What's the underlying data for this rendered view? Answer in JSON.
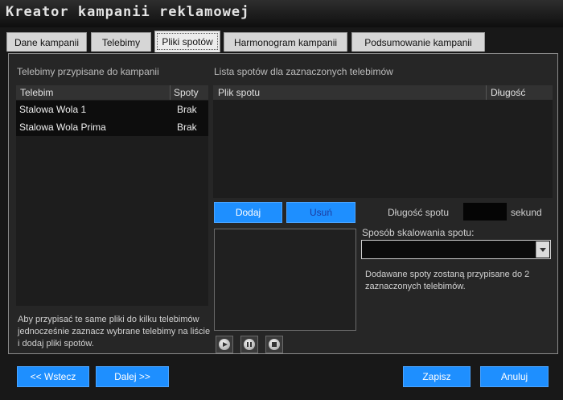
{
  "window": {
    "title": "Kreator kampanii reklamowej"
  },
  "tabs": [
    {
      "label": "Dane kampanii"
    },
    {
      "label": "Telebimy"
    },
    {
      "label": "Pliki spotów",
      "active": true
    },
    {
      "label": "Harmonogram kampanii"
    },
    {
      "label": "Podsumowanie kampanii"
    }
  ],
  "left": {
    "section_label": "Telebimy przypisane do kampanii",
    "columns": [
      "Telebim",
      "Spoty"
    ],
    "rows": [
      {
        "name": "Stalowa Wola 1",
        "spots": "Brak"
      },
      {
        "name": "Stalowa Wola Prima",
        "spots": "Brak"
      }
    ],
    "hint": "Aby przypisać te same pliki do kilku telebimów jednocześnie zaznacz wybrane telebimy na liście i dodaj pliki spotów."
  },
  "right": {
    "section_label": "Lista spotów dla zaznaczonych telebimów",
    "columns": [
      "Plik spotu",
      "Długość"
    ],
    "add_label": "Dodaj",
    "remove_label": "Usuń",
    "duration_label": "Długość spotu",
    "duration_value": "",
    "duration_unit": "sekund",
    "scaling_label": "Sposób skalowania spotu:",
    "scaling_value": "",
    "info": "Dodawane spoty zostaną przypisane do 2 zaznaczonych telebimów."
  },
  "player": {
    "icons": [
      "play-icon",
      "pause-icon",
      "stop-icon"
    ]
  },
  "footer": {
    "back_label": "<< Wstecz",
    "next_label": "Dalej >>",
    "save_label": "Zapisz",
    "cancel_label": "Anuluj"
  }
}
